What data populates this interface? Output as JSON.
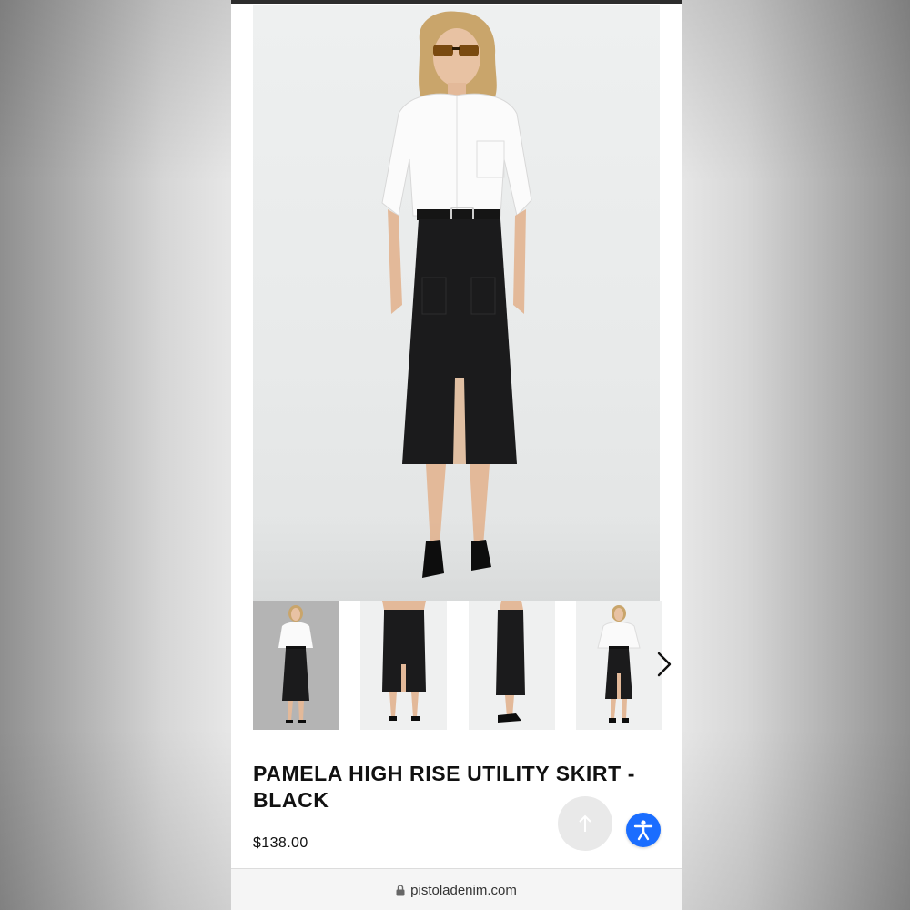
{
  "product": {
    "title": "PAMELA HIGH RISE UTILITY SKIRT - BLACK",
    "price": "$138.00"
  },
  "gallery": {
    "main_image": "model-front-full-look",
    "thumbnails": [
      {
        "name": "model-front-full-look",
        "selected": true
      },
      {
        "name": "skirt-front-closeup",
        "selected": false
      },
      {
        "name": "skirt-side-view",
        "selected": false
      },
      {
        "name": "model-front-slit-view",
        "selected": false
      }
    ],
    "next_icon": "chevron-right-icon"
  },
  "browser": {
    "url": "pistoladenim.com",
    "lock_icon": "lock-icon"
  },
  "buttons": {
    "scroll_top_icon": "arrow-up-icon",
    "accessibility_icon": "accessibility-icon"
  },
  "colors": {
    "accent": "#1a6dff",
    "text": "#111111"
  }
}
